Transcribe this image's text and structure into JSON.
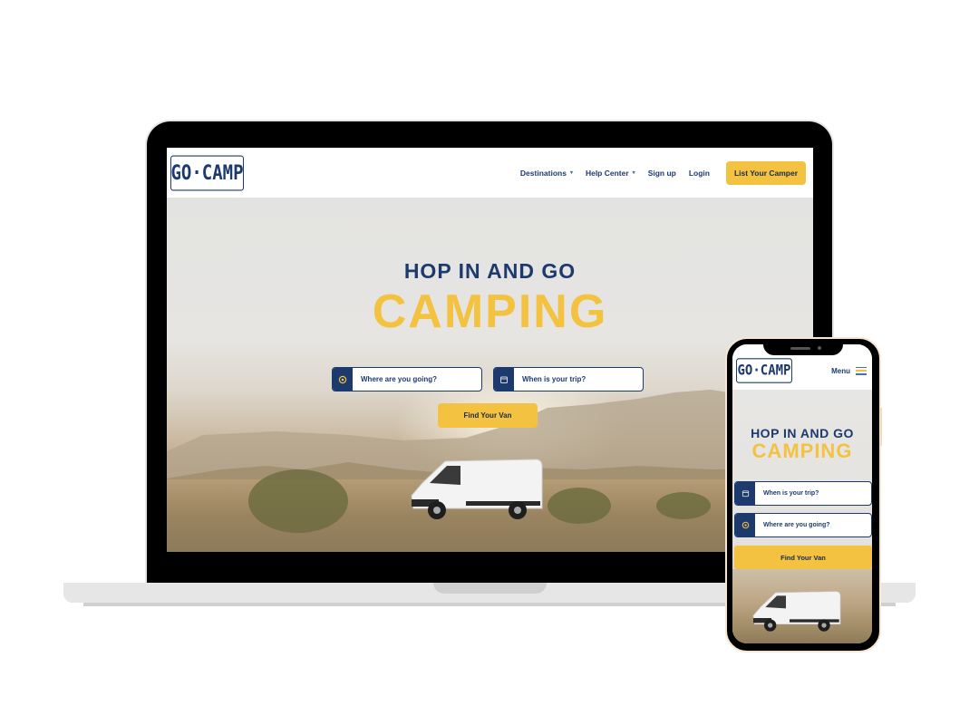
{
  "brand": {
    "logo_text": "GO·CAMP",
    "primary_color": "#1d3a6e",
    "accent_color": "#f2c240"
  },
  "desktop": {
    "nav": {
      "links": [
        {
          "label": "Destinations",
          "has_dropdown": true
        },
        {
          "label": "Help Center",
          "has_dropdown": true
        },
        {
          "label": "Sign up",
          "has_dropdown": false
        },
        {
          "label": "Login",
          "has_dropdown": false
        }
      ],
      "cta_label": "List Your Camper",
      "dropdown_glyph": "▾"
    },
    "hero": {
      "title_small": "HOP IN AND GO",
      "title_big": "CAMPING",
      "destination_placeholder": "Where are you going?",
      "date_placeholder": "When is your trip?",
      "find_button": "Find Your Van"
    }
  },
  "mobile": {
    "nav": {
      "menu_label": "Menu"
    },
    "hero": {
      "title_small": "HOP IN AND GO",
      "title_big": "CAMPING",
      "date_placeholder": "When is your trip?",
      "destination_placeholder": "Where are you going?",
      "find_button": "Find Your Van"
    }
  },
  "icons": {
    "location": "location-pin-icon",
    "calendar": "calendar-icon",
    "menu": "hamburger-menu-icon"
  }
}
